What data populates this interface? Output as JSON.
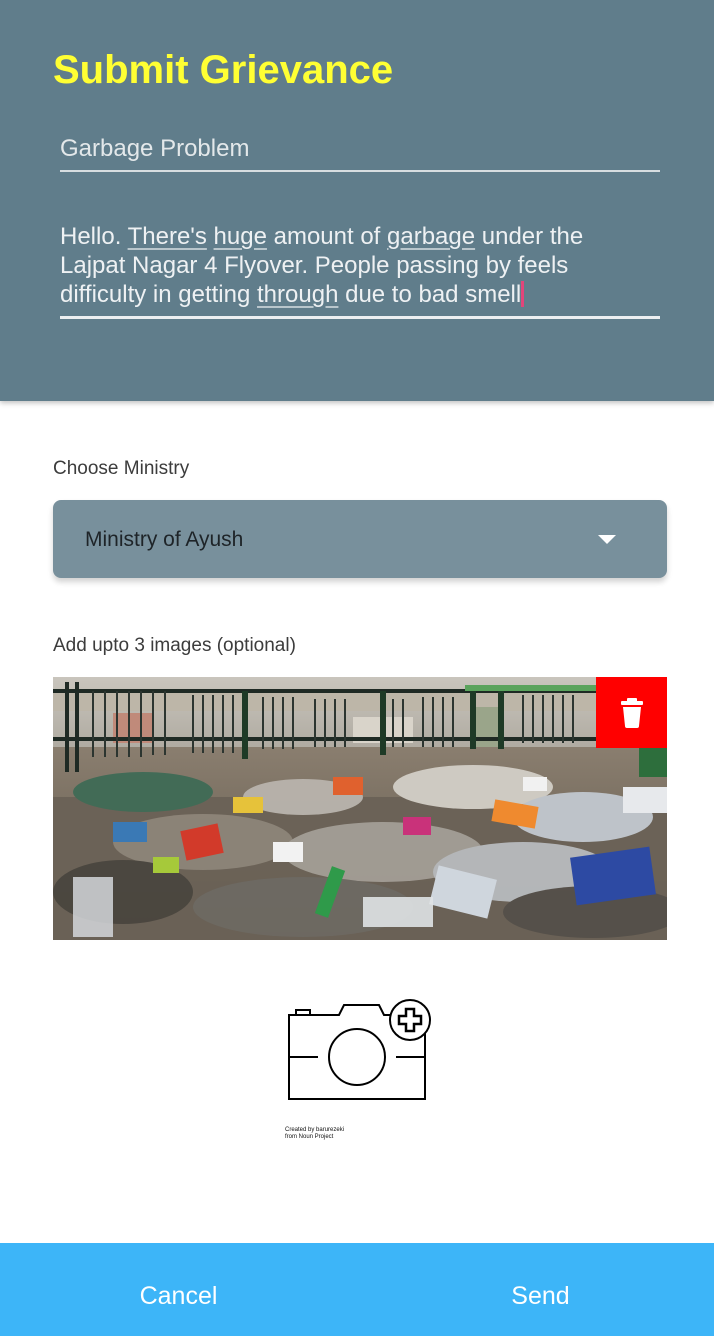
{
  "header": {
    "title": "Submit Grievance",
    "subject_value": "Garbage Problem",
    "description_value": {
      "w1": "Hello. ",
      "w2": "There's",
      "w3": " ",
      "w4": "huge",
      "w5": " amount of ",
      "w6": "garbage",
      "w7": " under the\nLajpat Nagar 4 Flyover. People passing by feels\ndifficulty in getting ",
      "w8": "through",
      "w9": " due to bad smell"
    }
  },
  "ministry": {
    "label": "Choose Ministry",
    "selected": "Ministry of Ayush"
  },
  "images": {
    "label": "Add upto 3 images (optional)",
    "delete_icon": "trash-icon",
    "add_icon": "camera-plus-icon",
    "credit_line1": "Created by barurezeki",
    "credit_line2": "from Noun Project"
  },
  "footer": {
    "cancel_label": "Cancel",
    "send_label": "Send"
  },
  "colors": {
    "header_bg": "#607d8b",
    "title": "#ffff33",
    "select_bg": "#78909c",
    "delete_bg": "#ff0000",
    "footer_bg": "#3db5f8"
  }
}
